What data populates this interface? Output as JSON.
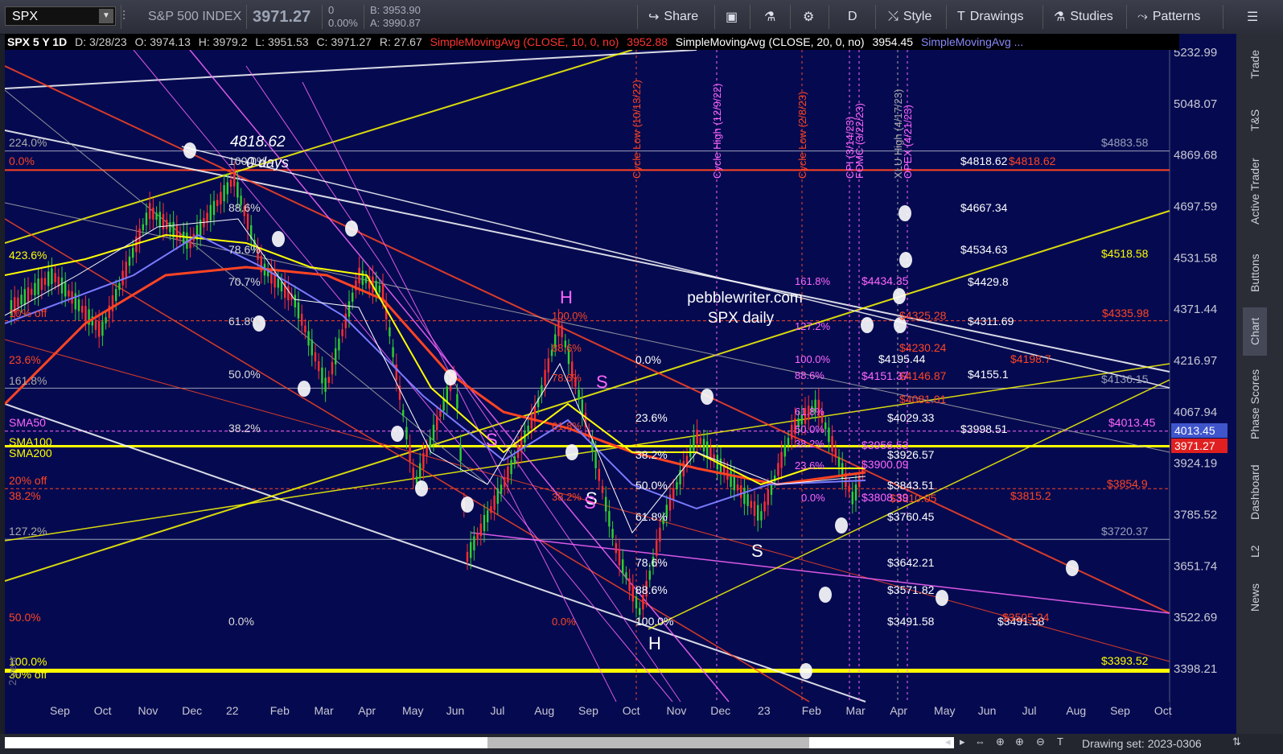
{
  "toolbar": {
    "symbol": "SPX",
    "description": "S&P 500 INDEX",
    "last": "3971.27",
    "change": "0",
    "change_pct": "0.00%",
    "bid": "B: 3953.90",
    "ask": "A: 3990.87",
    "share": "Share",
    "period": "D",
    "style": "Style",
    "drawings": "Drawings",
    "studies": "Studies",
    "patterns": "Patterns"
  },
  "legend": {
    "title": "SPX 5 Y 1D",
    "date": "D: 3/28/23",
    "open": "O: 3974.13",
    "high": "H: 3979.2",
    "low": "L: 3951.53",
    "close": "C: 3971.27",
    "range": "R: 27.67",
    "sma10": "SimpleMovingAvg (CLOSE, 10, 0, no)",
    "sma10_val": "3952.88",
    "sma20": "SimpleMovingAvg (CLOSE, 20, 0, no)",
    "sma20_val": "3954.45",
    "sma_more": "SimpleMovingAvg ..."
  },
  "chart_text": {
    "watermark1": "pebblewriter.com",
    "watermark2": "SPX daily",
    "peak_label": "4818.62",
    "peak_days": "0 days",
    "cycle_labels": [
      "Cycle Low (10/13/22)",
      "Cycle High (12/9/22)",
      "Cycle Low (2/8/23)",
      "CPI (3/14/23)",
      "FOMC (3/22/23)",
      "XLU High (4/17/23)",
      "OPEX (4/21/23)"
    ],
    "year_label": "2-year"
  },
  "price_axis": [
    "5232.99",
    "5048.07",
    "4869.68",
    "4697.59",
    "4531.58",
    "4371.44",
    "4216.97",
    "4067.94",
    "3924.19",
    "3785.52",
    "3651.74",
    "3522.69",
    "3398.21"
  ],
  "price_badges": {
    "blue": "4013.45",
    "red": "3971.27",
    "gray_top": "$4883.58",
    "gray_mid": "$4136.15",
    "gray_low": "$3720.37"
  },
  "time_axis": [
    "Sep",
    "Oct",
    "Nov",
    "Dec",
    "22",
    "Feb",
    "Mar",
    "Apr",
    "May",
    "Jun",
    "Jul",
    "Aug",
    "Sep",
    "Oct",
    "Nov",
    "Dec",
    "23",
    "Feb",
    "Mar",
    "Apr",
    "May",
    "Jun",
    "Jul",
    "Aug",
    "Sep",
    "Oct"
  ],
  "levels_white": [
    "$4818.62",
    "$4667.34",
    "$4534.63",
    "$4429.8",
    "$4311.69",
    "$4195.44",
    "$4155.1",
    "$4029.33",
    "$3998.51",
    "$3926.57",
    "$3843.51",
    "$3760.45",
    "$3642.21",
    "$3571.82",
    "$3491.58",
    "$3491.58"
  ],
  "levels_red": [
    "$4818.62",
    "$4335.98",
    "$4325.28",
    "$4230.24",
    "$4198.7",
    "$4146.87",
    "$4081.01",
    "$3854.9",
    "$3815.2",
    "$3810.05",
    "$3505.24"
  ],
  "levels_yellow": [
    "$4518.58",
    "$3393.52"
  ],
  "levels_pink": [
    "$4434.35",
    "$4151.37",
    "$3956.53",
    "$3900.09",
    "$3808.39",
    "$4013.45"
  ],
  "fib_left": [
    "224.0%",
    "0.0%",
    "423.6%",
    "10% off",
    "23.6%",
    "161.8%",
    "SMA50",
    "SMA100",
    "SMA200",
    "20% off",
    "38.2%",
    "127.2%",
    "50.0%",
    "100.0%",
    "30% off"
  ],
  "fib_mid": [
    "100.0%",
    "88.6%",
    "78.6%",
    "70.7%",
    "61.8%",
    "50.0%",
    "38.2%",
    "0.0%"
  ],
  "fib_right": [
    "0.0%",
    "23.6%",
    "38.2%",
    "50.0%",
    "61.8%",
    "78.6%",
    "88.6%",
    "100.0%"
  ],
  "fib_pink": [
    "100.0%",
    "88.6%",
    "78.6%",
    "61.8%",
    "38.2%",
    "0.0%"
  ],
  "fib_small": [
    "161.8%",
    "127.2%",
    "100.0%",
    "88.6%",
    "61.8%",
    "50.0%",
    "38.2%",
    "23.6%",
    "0.0%"
  ],
  "pattern_letters": [
    "H",
    "S",
    "S",
    "S",
    "H",
    "S",
    "S"
  ],
  "right_tabs": [
    "Trade",
    "T&S",
    "Active Trader",
    "Buttons",
    "Chart",
    "Phase Scores",
    "Dashboard",
    "L2",
    "News"
  ],
  "bottom": {
    "drawing_set": "Drawing set: 2023-0306"
  },
  "colors": {
    "chart_bg": "#050a50",
    "up": "#2fd02f",
    "down": "#ff2d2d",
    "sma10": "#ffffff",
    "sma20": "#ffff00",
    "sma50": "#7b7bff",
    "sma200": "#ff4422",
    "fib_pink": "#ff66ff"
  }
}
